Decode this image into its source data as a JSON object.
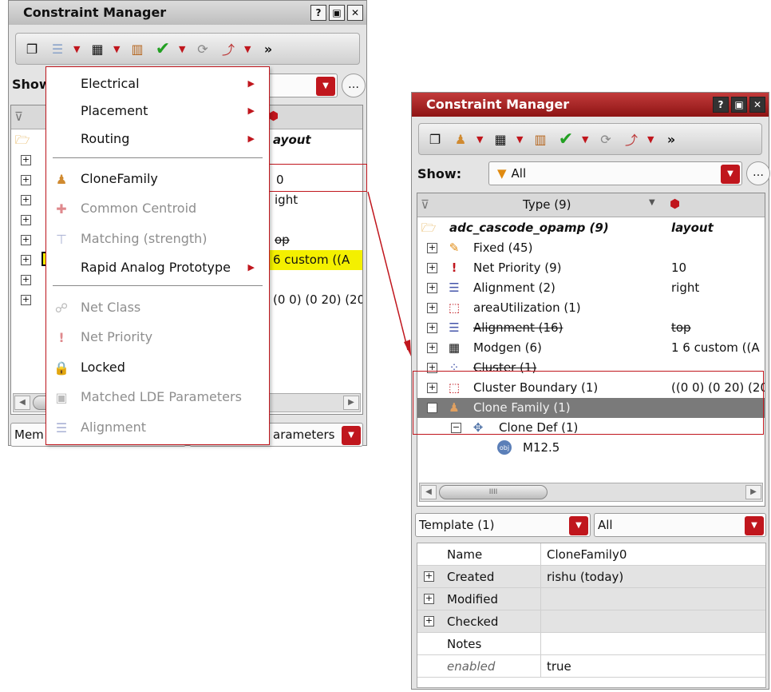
{
  "left_panel": {
    "title": "Constraint Manager",
    "show_label": "Show",
    "tree_rows": [
      {
        "value": "ayout"
      },
      {
        "value": "0"
      },
      {
        "value": "ight"
      },
      {
        "value": "op"
      },
      {
        "value": "6 custom ((A"
      },
      {
        "value": "(0 0) (0 20) (20"
      }
    ],
    "bottom_left": "Mem",
    "bottom_right": "arameters"
  },
  "context_menu": {
    "items": [
      {
        "label": "Electrical",
        "icon": "",
        "disabled": false,
        "submenu": true
      },
      {
        "label": "Placement",
        "icon": "",
        "disabled": false,
        "submenu": true
      },
      {
        "label": "Routing",
        "icon": "",
        "disabled": false,
        "submenu": true
      },
      {
        "label": "CloneFamily",
        "icon": "clone-family-icon",
        "disabled": false,
        "submenu": false
      },
      {
        "label": "Common Centroid",
        "icon": "common-centroid-icon",
        "disabled": true,
        "submenu": false
      },
      {
        "label": "Matching (strength)",
        "icon": "matching-icon",
        "disabled": true,
        "submenu": false
      },
      {
        "label": "Rapid Analog Prototype",
        "icon": "",
        "disabled": false,
        "submenu": true
      },
      {
        "label": "Net Class",
        "icon": "net-class-icon",
        "disabled": true,
        "submenu": false
      },
      {
        "label": "Net Priority",
        "icon": "net-priority-icon",
        "disabled": true,
        "submenu": false
      },
      {
        "label": "Locked",
        "icon": "lock-icon",
        "disabled": false,
        "submenu": false
      },
      {
        "label": "Matched LDE Parameters",
        "icon": "lde-parameters-icon",
        "disabled": true,
        "submenu": false
      },
      {
        "label": "Alignment",
        "icon": "alignment-icon",
        "disabled": true,
        "submenu": false
      }
    ]
  },
  "right_panel": {
    "title": "Constraint Manager",
    "show_label": "Show:",
    "show_value": "All",
    "type_header": "Type (9)",
    "root": {
      "label": "adc_cascode_opamp (9)",
      "value": "layout"
    },
    "rows": [
      {
        "label": "Fixed (45)",
        "value": "",
        "icon": "pencil-icon",
        "strike": false
      },
      {
        "label": "Net Priority (9)",
        "value": "10",
        "icon": "net-priority-icon",
        "strike": false
      },
      {
        "label": "Alignment (2)",
        "value": "right",
        "icon": "alignment-icon",
        "strike": false
      },
      {
        "label": "areaUtilization (1)",
        "value": "",
        "icon": "area-utilization-icon",
        "strike": false
      },
      {
        "label": "Alignment (16)",
        "value": "top",
        "icon": "alignment-icon",
        "strike": true
      },
      {
        "label": "Modgen (6)",
        "value": "1 6 custom ((A",
        "icon": "modgen-icon",
        "strike": false
      },
      {
        "label": "Cluster (1)",
        "value": "",
        "icon": "cluster-icon",
        "strike": true
      },
      {
        "label": "Cluster Boundary (1)",
        "value": "((0 0) (0 20) (20",
        "icon": "cluster-boundary-icon",
        "strike": false
      },
      {
        "label": "Clone Family (1)",
        "value": "",
        "icon": "clone-family-icon",
        "strike": false
      },
      {
        "label": "Clone Def (1)",
        "value": "",
        "icon": "clone-def-icon",
        "strike": false
      },
      {
        "label": "M12.5",
        "value": "",
        "icon": "instance-icon",
        "strike": false
      }
    ],
    "template_combo": "Template (1)",
    "filter_combo": "All",
    "properties": [
      {
        "key": "Name",
        "value": "CloneFamily0",
        "expandable": false
      },
      {
        "key": "Created",
        "value": "rishu (today)",
        "expandable": true
      },
      {
        "key": "Modified",
        "value": "",
        "expandable": true
      },
      {
        "key": "Checked",
        "value": "",
        "expandable": true
      },
      {
        "key": "Notes",
        "value": "",
        "expandable": false
      },
      {
        "key": "enabled",
        "value": "true",
        "expandable": false
      }
    ]
  }
}
